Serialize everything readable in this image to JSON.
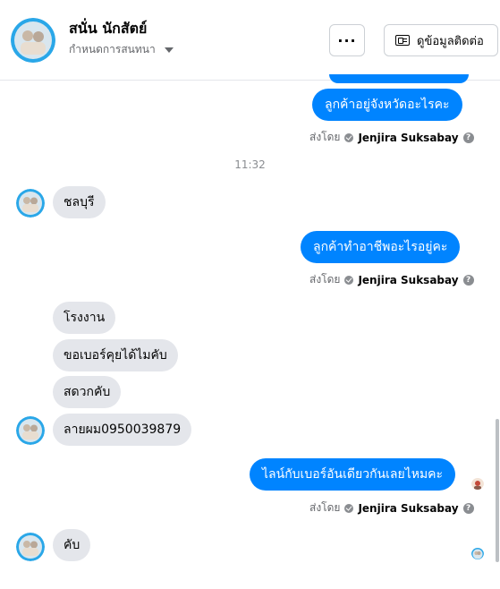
{
  "header": {
    "name": "สนั่น นักสัตย์",
    "subtitle": "กำหนดการสนทนา",
    "more_label": "···",
    "contact_label": "ดูข้อมูลติดต่อ"
  },
  "messages": {
    "out1": "ลูกค้าอยู่จังหวัดอะไรคะ",
    "in1": "ชลบุรี",
    "out2": "ลูกค้าทำอาชีพอะไรอยู่คะ",
    "in2a": "โรงงาน",
    "in2b": "ขอเบอร์คุยได้ไมคับ",
    "in2c": "สดวกคับ",
    "in2d": "ลายผม0950039879",
    "out3": "ไลน์กับเบอร์อันเดียวกันเลยไหมคะ",
    "in3": "คับ"
  },
  "sent_by": {
    "prefix": "ส่งโดย",
    "agent": "Jenjira Suksabay",
    "help": "?"
  },
  "time_separator": "11:32",
  "colors": {
    "outgoing": "#0084ff",
    "incoming": "#e4e6eb"
  },
  "icons": {
    "more": "more-dots-icon",
    "contact": "contact-card-icon",
    "dropdown": "chevron-down-icon",
    "verified": "check-circle-icon",
    "help": "help-circle-icon"
  }
}
